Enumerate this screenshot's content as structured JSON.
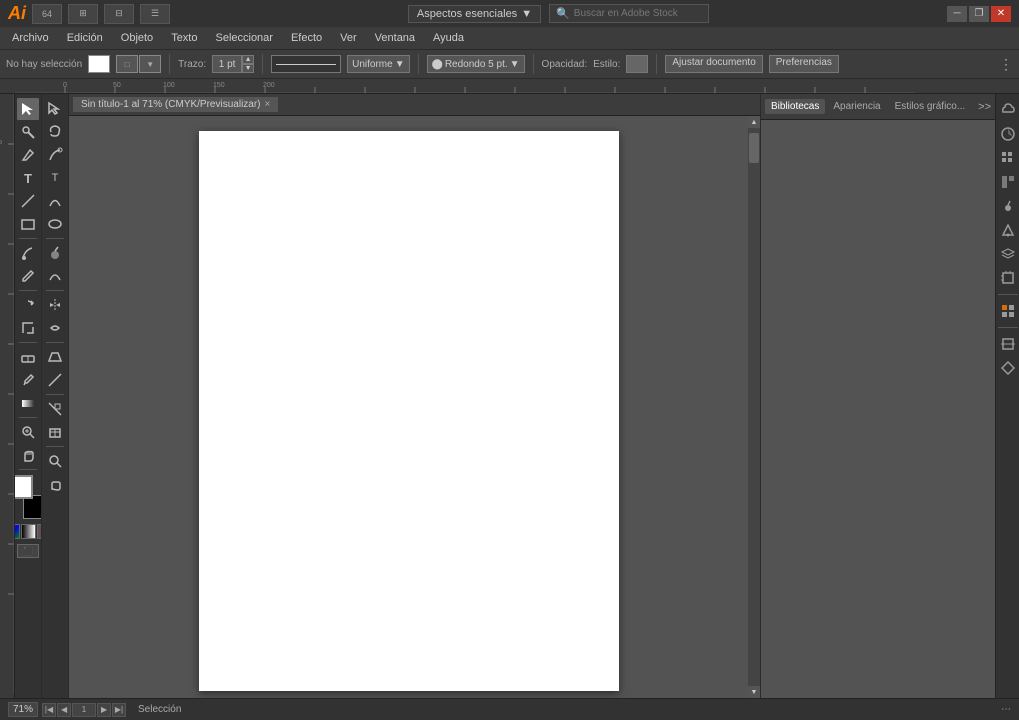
{
  "titlebar": {
    "logo": "Ai",
    "workspace": "Aspectos esenciales",
    "search_placeholder": "Buscar en Adobe Stock",
    "btn_minimize": "─",
    "btn_restore": "❐",
    "btn_close": "✕"
  },
  "menubar": {
    "items": [
      "Archivo",
      "Edición",
      "Objeto",
      "Texto",
      "Seleccionar",
      "Efecto",
      "Ver",
      "Ventana",
      "Ayuda"
    ]
  },
  "optionsbar": {
    "no_selection": "No hay selección",
    "trazo_label": "Trazo:",
    "trazo_value": "1 pt",
    "stroke_type": "Uniforme",
    "redondo_label": "Redondo 5 pt.",
    "opacidad_label": "Opacidad:",
    "estilo_label": "Estilo:",
    "ajustar_btn": "Ajustar documento",
    "preferencias_btn": "Preferencias"
  },
  "canvas": {
    "tab_title": "Sin título-1 al 71% (CMYK/Previsualizar)",
    "tab_close": "×"
  },
  "panels": {
    "tabs": [
      "Bibliotecas",
      "Apariencia",
      "Estilos gráfico..."
    ],
    "more": ">>"
  },
  "statusbar": {
    "zoom": "71%",
    "page_label": "Selección"
  },
  "toolbar": {
    "tools": [
      {
        "name": "selection-tool",
        "icon": "↖",
        "label": "Selección"
      },
      {
        "name": "direct-selection",
        "icon": "↗",
        "label": "Selección directa"
      },
      {
        "name": "magic-wand",
        "icon": "✦",
        "label": "Varita mágica"
      },
      {
        "name": "lasso",
        "icon": "⌒",
        "label": "Lazo"
      },
      {
        "name": "pen",
        "icon": "✒",
        "label": "Pluma"
      },
      {
        "name": "type",
        "icon": "T",
        "label": "Texto"
      },
      {
        "name": "line",
        "icon": "╱",
        "label": "Línea"
      },
      {
        "name": "rectangle",
        "icon": "□",
        "label": "Rectángulo"
      },
      {
        "name": "rotate",
        "icon": "↻",
        "label": "Rotar"
      },
      {
        "name": "scale",
        "icon": "⤡",
        "label": "Escalar"
      },
      {
        "name": "paintbrush",
        "icon": "✏",
        "label": "Pincel"
      },
      {
        "name": "pencil",
        "icon": "✎",
        "label": "Lápiz"
      },
      {
        "name": "eraser",
        "icon": "⌫",
        "label": "Borrador"
      },
      {
        "name": "eyedropper",
        "icon": "⊘",
        "label": "Cuentagotas"
      },
      {
        "name": "gradient",
        "icon": "■",
        "label": "Degradado"
      },
      {
        "name": "zoom",
        "icon": "⊕",
        "label": "Zoom"
      },
      {
        "name": "hand",
        "icon": "✋",
        "label": "Mano"
      }
    ]
  }
}
